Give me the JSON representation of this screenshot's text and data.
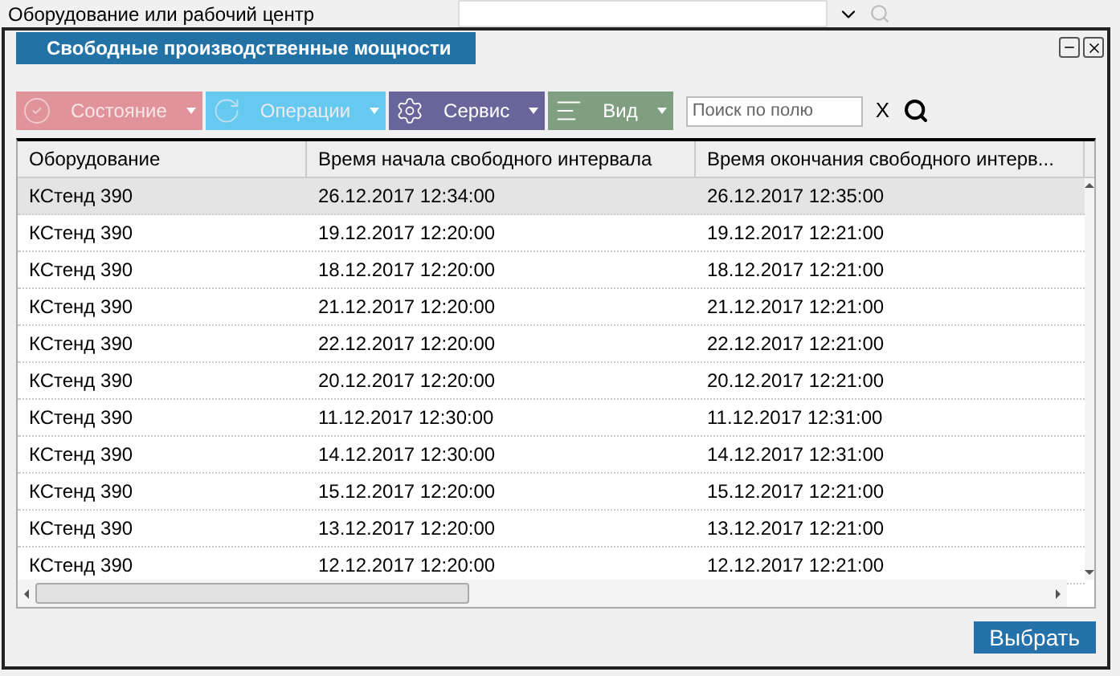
{
  "background": {
    "field_label": "Оборудование или рабочий центр"
  },
  "dialog": {
    "title": "Свободные производственные мощности",
    "toolbar": [
      {
        "label": "Состояние",
        "kind": "status",
        "color": "#e0939b",
        "disabled": true
      },
      {
        "label": "Операции",
        "kind": "operations",
        "color": "#66c9f0",
        "disabled": true
      },
      {
        "label": "Сервис",
        "kind": "service",
        "color": "#68659a",
        "disabled": false
      },
      {
        "label": "Вид",
        "kind": "view",
        "color": "#7f9f80",
        "disabled": false
      }
    ],
    "search": {
      "placeholder": "Поиск по полю",
      "clear": "X"
    },
    "table": {
      "columns": [
        "Оборудование",
        "Время начала свободного интервала",
        "Время окончания свободного интерв..."
      ],
      "rows": [
        {
          "cells": [
            "КСтенд 390",
            "26.12.2017 12:34:00",
            "26.12.2017 12:35:00"
          ],
          "selected": true
        },
        {
          "cells": [
            "КСтенд 390",
            "19.12.2017 12:20:00",
            "19.12.2017 12:21:00"
          ],
          "selected": false
        },
        {
          "cells": [
            "КСтенд 390",
            "18.12.2017 12:20:00",
            "18.12.2017 12:21:00"
          ],
          "selected": false
        },
        {
          "cells": [
            "КСтенд 390",
            "21.12.2017 12:20:00",
            "21.12.2017 12:21:00"
          ],
          "selected": false
        },
        {
          "cells": [
            "КСтенд 390",
            "22.12.2017 12:20:00",
            "22.12.2017 12:21:00"
          ],
          "selected": false
        },
        {
          "cells": [
            "КСтенд 390",
            "20.12.2017 12:20:00",
            "20.12.2017 12:21:00"
          ],
          "selected": false
        },
        {
          "cells": [
            "КСтенд 390",
            "11.12.2017 12:30:00",
            "11.12.2017 12:31:00"
          ],
          "selected": false
        },
        {
          "cells": [
            "КСтенд 390",
            "14.12.2017 12:30:00",
            "14.12.2017 12:31:00"
          ],
          "selected": false
        },
        {
          "cells": [
            "КСтенд 390",
            "15.12.2017 12:20:00",
            "15.12.2017 12:21:00"
          ],
          "selected": false
        },
        {
          "cells": [
            "КСтенд 390",
            "13.12.2017 12:20:00",
            "13.12.2017 12:21:00"
          ],
          "selected": false
        },
        {
          "cells": [
            "КСтенд 390",
            "12.12.2017 12:20:00",
            "12.12.2017 12:21:00"
          ],
          "selected": false
        }
      ]
    },
    "button": "Выбрать"
  }
}
